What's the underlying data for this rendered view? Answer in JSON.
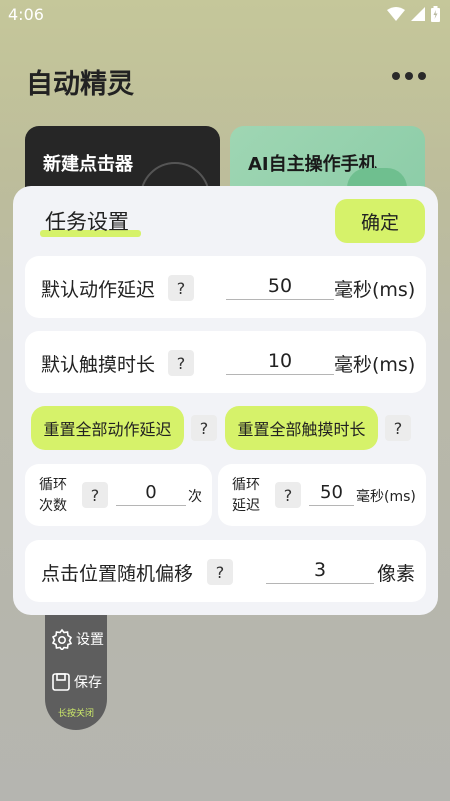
{
  "status": {
    "time": "4:06"
  },
  "app": {
    "title": "自动精灵"
  },
  "cards": {
    "new_clicker": "新建点击器",
    "ai_operate": "AI自主操作手机"
  },
  "float_panel": {
    "settings": "设置",
    "save": "保存",
    "hint": "长按关闭"
  },
  "dialog": {
    "title": "任务设置",
    "confirm": "确定",
    "help_symbol": "?",
    "action_delay": {
      "label": "默认动作延迟",
      "value": "50",
      "unit": "毫秒(ms)"
    },
    "touch_duration": {
      "label": "默认触摸时长",
      "value": "10",
      "unit": "毫秒(ms)"
    },
    "reset_delay": "重置全部动作延迟",
    "reset_touch": "重置全部触摸时长",
    "loop_count": {
      "label_line1": "循环",
      "label_line2": "次数",
      "value": "0",
      "unit": "次"
    },
    "loop_delay": {
      "label_line1": "循环",
      "label_line2": "延迟",
      "value": "50",
      "unit": "毫秒(ms)"
    },
    "random_offset": {
      "label": "点击位置随机偏移",
      "value": "3",
      "unit": "像素"
    }
  }
}
